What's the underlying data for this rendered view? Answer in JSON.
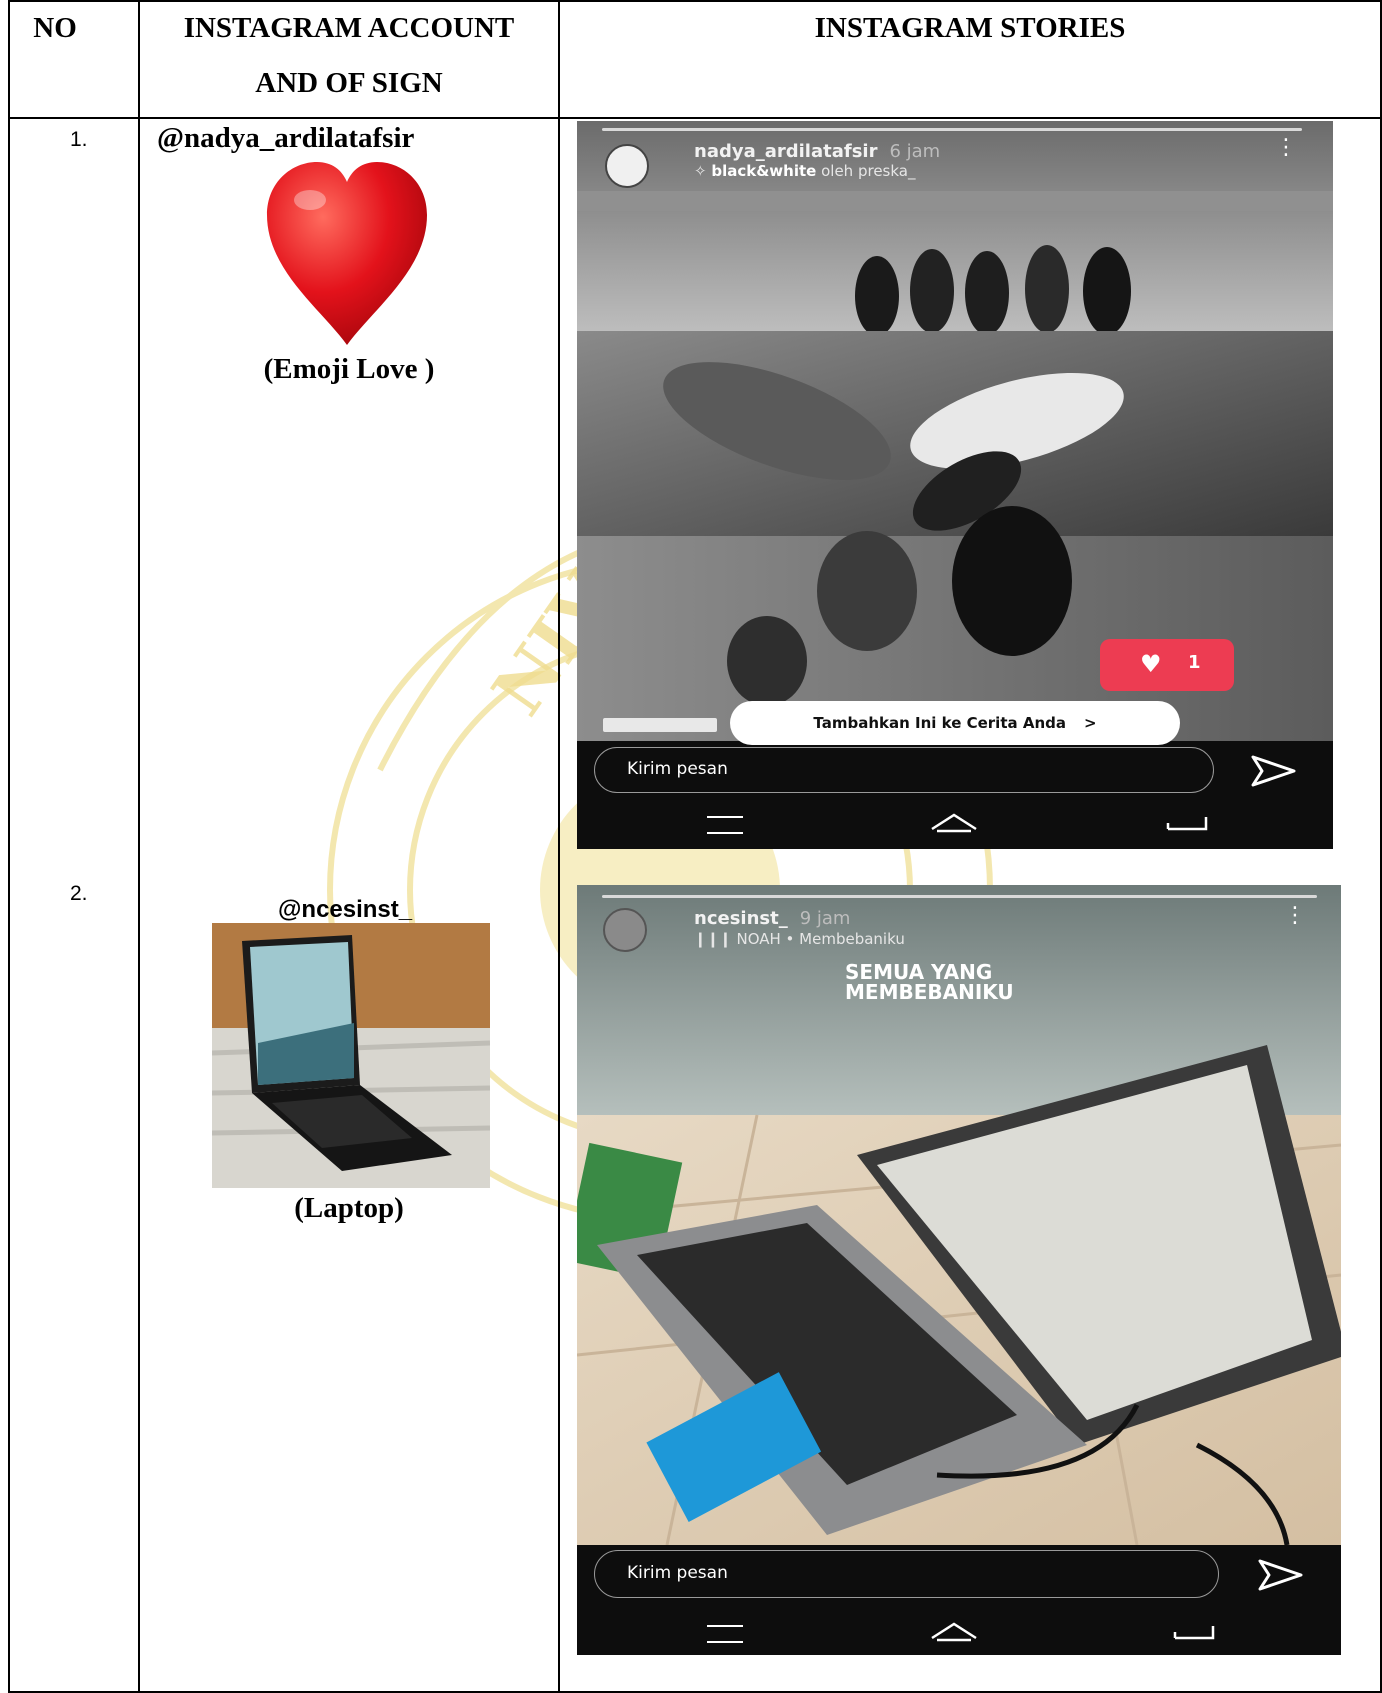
{
  "table": {
    "headers": {
      "no": "NO",
      "account_line1": "INSTAGRAM ACCOUNT",
      "account_line2": "AND OF SIGN",
      "stories": "INSTAGRAM STORIES"
    },
    "rows": [
      {
        "no": "1.",
        "account": "@nadya_ardilatafsir",
        "sign_caption": "(Emoji Love )",
        "sign_icon": "heart-emoji-icon",
        "story": {
          "username": "nadya_ardilatafsir",
          "time": "6 jam",
          "music_title": "black&white",
          "music_rest": "oleh preska_",
          "like_count": "1",
          "add_to_story": "Tambahkan Ini ke Cerita Anda",
          "message_placeholder": "Kirim pesan"
        }
      },
      {
        "no": "2.",
        "account": "@ncesinst_",
        "sign_caption": "(Laptop)",
        "sign_icon": "laptop-photo-icon",
        "story": {
          "username": "ncesinst_",
          "time": "9 jam",
          "music": "NOAH • Membebaniku",
          "overlay_line1": "SEMUA YANG",
          "overlay_line2": "MEMBEBANIKU",
          "message_placeholder": "Kirim pesan"
        }
      }
    ]
  },
  "colors": {
    "watermark": "#f3e4a0",
    "like_badge": "#ed3c52",
    "laptop_panel": "#1e98d8"
  }
}
